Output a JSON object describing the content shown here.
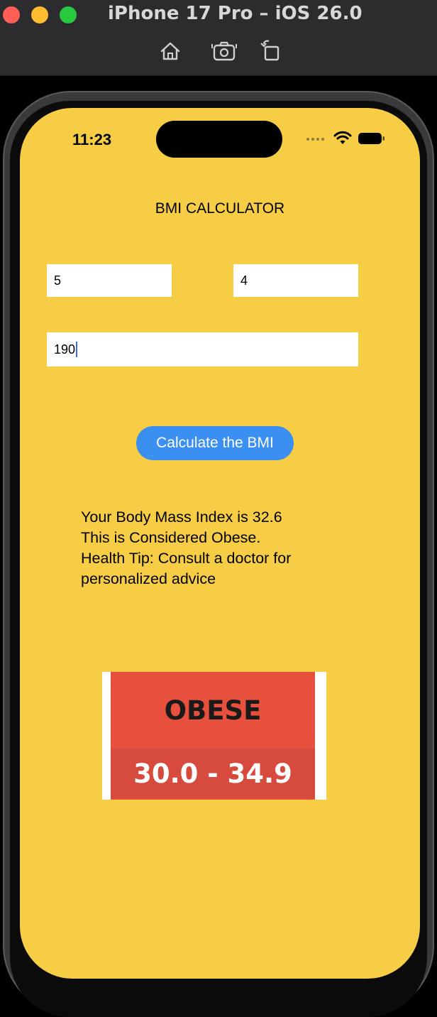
{
  "window": {
    "title": "iPhone 17 Pro – iOS 26.0"
  },
  "toolbar": {
    "icons": [
      "home-icon",
      "screenshot-icon",
      "rotate-icon"
    ]
  },
  "status_bar": {
    "time": "11:23"
  },
  "app": {
    "title": "BMI CALCULATOR",
    "feet_value": "5",
    "inches_value": "4",
    "weight_value": "190",
    "button_label": "Calculate the BMI",
    "result_lines": [
      "Your Body Mass Index is 32.6",
      "This is Considered Obese.",
      "Health Tip: Consult a doctor for",
      "personalized advice"
    ],
    "category_label": "OBESE",
    "category_range": "30.0 - 34.9"
  },
  "colors": {
    "screen_bg": "#f6cd45",
    "button_bg": "#3b8ff0",
    "category_red": "#e8503e"
  }
}
